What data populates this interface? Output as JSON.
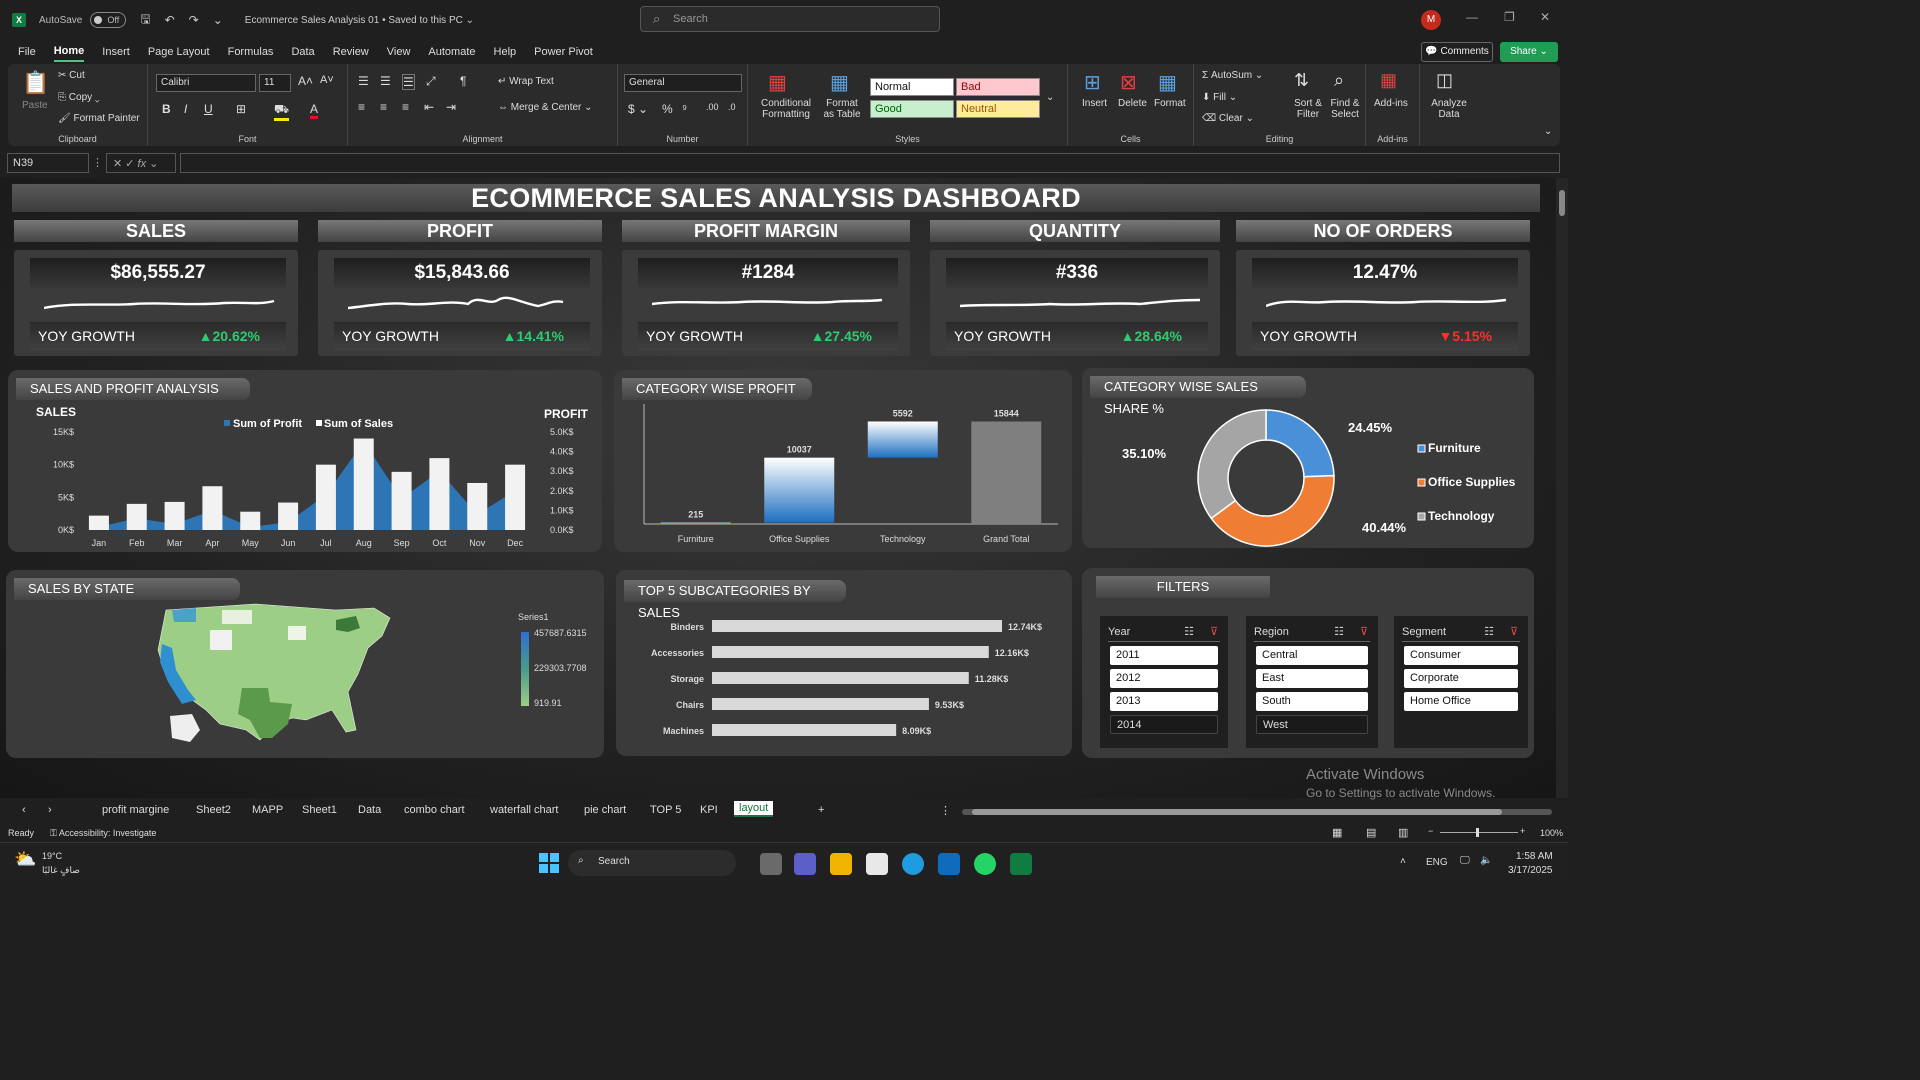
{
  "titlebar": {
    "autosave_label": "AutoSave",
    "autosave_state": "Off",
    "doc_title": "Ecommerce Sales Analysis 01 • Saved to this PC ⌄",
    "search_placeholder": "Search",
    "avatar_initial": "M"
  },
  "menu": [
    "File",
    "Home",
    "Insert",
    "Page Layout",
    "Formulas",
    "Data",
    "Review",
    "View",
    "Automate",
    "Help",
    "Power Pivot"
  ],
  "menu_active": "Home",
  "buttons": {
    "comments": "Comments",
    "share": "Share"
  },
  "ribbon": {
    "clipboard": {
      "label": "Clipboard",
      "paste": "Paste",
      "cut": "Cut",
      "copy": "Copy",
      "format_painter": "Format Painter"
    },
    "font": {
      "label": "Font",
      "name": "Calibri",
      "size": "11"
    },
    "alignment": {
      "label": "Alignment",
      "wrap_text": "Wrap Text",
      "merge_center": "Merge & Center"
    },
    "number": {
      "label": "Number",
      "format": "General"
    },
    "styles": {
      "label": "Styles",
      "cond_format": "Conditional Formatting",
      "format_table": "Format as Table",
      "normal": "Normal",
      "bad": "Bad",
      "good": "Good",
      "neutral": "Neutral"
    },
    "cells": {
      "label": "Cells",
      "insert": "Insert",
      "delete": "Delete",
      "format": "Format"
    },
    "editing": {
      "label": "Editing",
      "autosum": "AutoSum",
      "fill": "Fill",
      "clear": "Clear",
      "sort_filter": "Sort & Filter",
      "find_select": "Find & Select"
    },
    "addins": {
      "label": "Add-ins",
      "addins": "Add-ins",
      "analyze": "Analyze Data"
    }
  },
  "namebox": "N39",
  "fx": "fx",
  "dashboard": {
    "title": "ECOMMERCE SALES ANALYSIS DASHBOARD",
    "yoy_label": "YOY GROWTH",
    "kpis": [
      {
        "title": "SALES",
        "value": "$86,555.27",
        "growth": "▲20.62%",
        "dir": "up"
      },
      {
        "title": "PROFIT",
        "value": "$15,843.66",
        "growth": "▲14.41%",
        "dir": "up"
      },
      {
        "title": "PROFIT MARGIN",
        "value": "#1284",
        "growth": "▲27.45%",
        "dir": "up"
      },
      {
        "title": "QUANTITY",
        "value": "#336",
        "growth": "▲28.64%",
        "dir": "up"
      },
      {
        "title": "NO OF ORDERS",
        "value": "12.47%",
        "growth": "▼5.15%",
        "dir": "down"
      }
    ],
    "panels": {
      "sales_profit": "SALES AND PROFIT ANALYSIS",
      "category_profit": "CATEGORY WISE PROFIT",
      "category_share": "CATEGORY WISE SALES SHARE %",
      "state": "SALES BY STATE",
      "top5": "TOP 5 SUBCATEGORIES BY SALES",
      "filters": "FILTERS"
    },
    "map_legend": {
      "series": "Series1",
      "max": "457687.6315",
      "mid": "229303.7708",
      "min": "919.91"
    },
    "slicers": [
      {
        "title": "Year",
        "items": [
          "2011",
          "2012",
          "2013",
          "2014"
        ],
        "selected": [
          true,
          true,
          true,
          false
        ]
      },
      {
        "title": "Region",
        "items": [
          "Central",
          "East",
          "South",
          "West"
        ],
        "selected": [
          true,
          true,
          true,
          false
        ]
      },
      {
        "title": "Segment",
        "items": [
          "Consumer",
          "Corporate",
          "Home Office"
        ],
        "selected": [
          true,
          true,
          true
        ]
      }
    ]
  },
  "chart_data": [
    {
      "type": "bar",
      "title": "",
      "ylabel": "SALES",
      "y2label": "PROFIT",
      "categories": [
        "Jan",
        "Feb",
        "Mar",
        "Apr",
        "May",
        "Jun",
        "Jul",
        "Aug",
        "Sep",
        "Oct",
        "Nov",
        "Dec"
      ],
      "series": [
        {
          "name": "Sum of Sales",
          "type": "bar",
          "axis": "left",
          "values": [
            2200,
            4000,
            4300,
            6700,
            2800,
            4200,
            10000,
            14000,
            8900,
            11000,
            7200,
            10000
          ]
        },
        {
          "name": "Sum of Profit",
          "type": "area",
          "axis": "right",
          "values": [
            150,
            600,
            300,
            1000,
            150,
            400,
            1800,
            4500,
            1600,
            3000,
            800,
            2000
          ]
        }
      ],
      "y_ticks": [
        "0K$",
        "5K$",
        "10K$",
        "15K$"
      ],
      "y2_ticks": [
        "0.0K$",
        "1.0K$",
        "2.0K$",
        "3.0K$",
        "4.0K$",
        "5.0K$"
      ],
      "ylim": [
        0,
        15000
      ],
      "y2lim": [
        0,
        5000
      ]
    },
    {
      "type": "bar",
      "subtype": "waterfall",
      "categories": [
        "Furniture",
        "Office Supplies",
        "Technology",
        "Grand Total"
      ],
      "values": [
        215,
        10037,
        5592,
        15844
      ],
      "labels": [
        "215",
        "10037",
        "5592",
        "15844"
      ],
      "ylim": [
        0,
        17000
      ]
    },
    {
      "type": "pie",
      "subtype": "donut",
      "categories": [
        "Furniture",
        "Office Supplies",
        "Technology"
      ],
      "values": [
        24.45,
        40.44,
        35.1
      ],
      "labels": [
        "24.45%",
        "40.44%",
        "35.10%"
      ],
      "colors": [
        "#4a90d9",
        "#ef7d33",
        "#a5a5a5"
      ]
    },
    {
      "type": "bar",
      "orientation": "horizontal",
      "categories": [
        "Binders",
        "Accessories",
        "Storage",
        "Chairs",
        "Machines"
      ],
      "values": [
        12.74,
        12.16,
        11.28,
        9.53,
        8.09
      ],
      "labels": [
        "12.74K$",
        "12.16K$",
        "11.28K$",
        "9.53K$",
        "8.09K$"
      ]
    }
  ],
  "watermark": {
    "line1": "Activate Windows",
    "line2": "Go to Settings to activate Windows."
  },
  "sheet_tabs": [
    "profit margine",
    "Sheet2",
    "MAPP",
    "Sheet1",
    "Data",
    "combo chart",
    "waterfall chart",
    "pie chart",
    "TOP 5",
    "KPI",
    "layout"
  ],
  "active_tab": "layout",
  "status": {
    "ready": "Ready",
    "accessibility": "Accessibility: Investigate",
    "zoom": "100%"
  },
  "taskbar": {
    "temp": "19°C",
    "weather": "صافٍ غالبًا",
    "search": "Search",
    "lang": "ENG",
    "time": "1:58 AM",
    "date": "3/17/2025"
  }
}
